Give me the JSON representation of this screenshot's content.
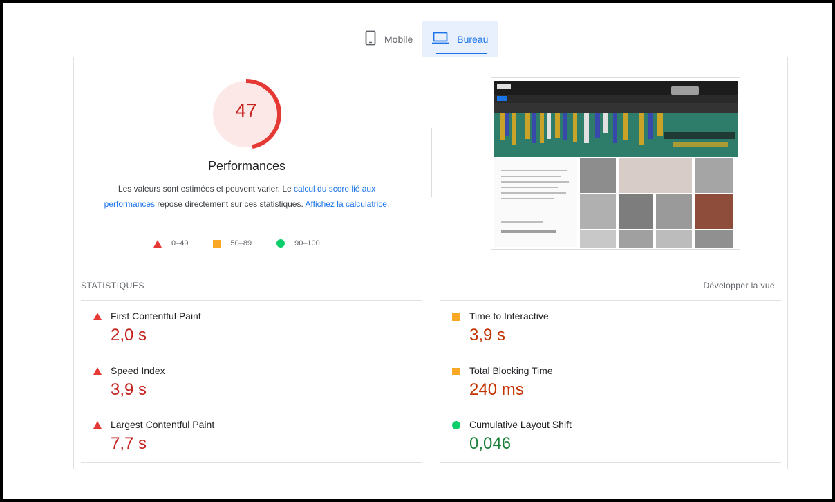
{
  "tabs": [
    {
      "label": "Mobile",
      "icon": "mobile-phone-icon",
      "active": false
    },
    {
      "label": "Bureau",
      "icon": "laptop-icon",
      "active": true
    }
  ],
  "performance": {
    "score": "47",
    "score_fraction": 0.47,
    "title": "Performances",
    "desc_part1": "Les valeurs sont estimées et peuvent varier. Le ",
    "desc_link1": "calcul du score lié aux performances",
    "desc_part2": " repose directement sur ces statistiques. ",
    "desc_link2": "Affichez la calculatrice",
    "desc_part3": "."
  },
  "legend": [
    {
      "range": "0–49",
      "shape": "triangle",
      "color": "#e53935"
    },
    {
      "range": "50–89",
      "shape": "square",
      "color": "#f9a825"
    },
    {
      "range": "90–100",
      "shape": "circle",
      "color": "#0cce6b"
    }
  ],
  "stats": {
    "label": "STATISTIQUES",
    "expand": "Développer la vue"
  },
  "metrics_left": [
    {
      "name": "First Contentful Paint",
      "value": "2,0 s",
      "status": "poor"
    },
    {
      "name": "Speed Index",
      "value": "3,9 s",
      "status": "poor"
    },
    {
      "name": "Largest Contentful Paint",
      "value": "7,7 s",
      "status": "poor"
    }
  ],
  "metrics_right": [
    {
      "name": "Time to Interactive",
      "value": "3,9 s",
      "status": "average"
    },
    {
      "name": "Total Blocking Time",
      "value": "240 ms",
      "status": "average"
    },
    {
      "name": "Cumulative Layout Shift",
      "value": "0,046",
      "status": "good"
    }
  ],
  "colors": {
    "accent": "#1a73e8",
    "poor": "#c5221f",
    "average": "#c33300",
    "good": "#188038",
    "gauge_bg": "#fce8e6",
    "gauge_arc": "#e53935"
  }
}
